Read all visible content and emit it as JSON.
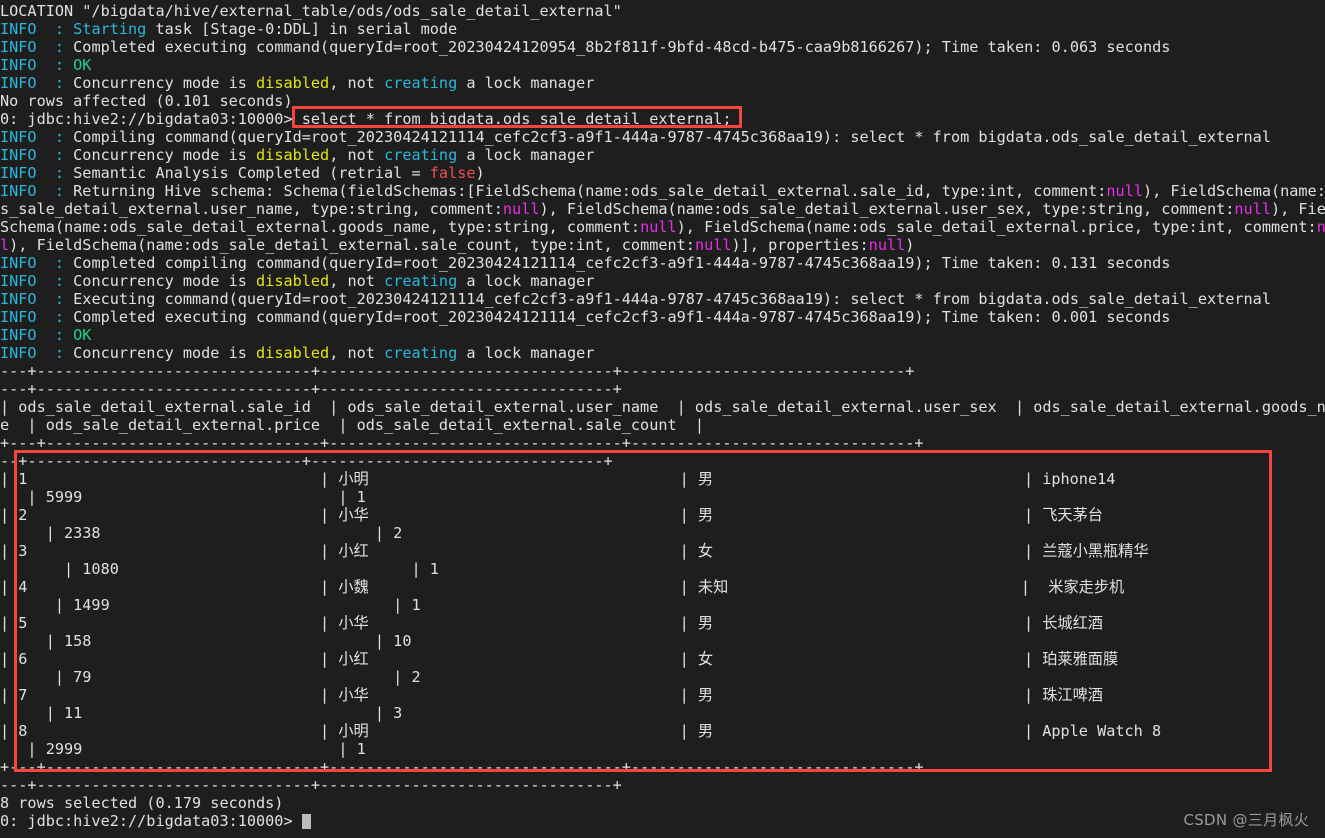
{
  "terminal": {
    "background_color": "#1e1e1e",
    "foreground_color": "#d8d8d8",
    "highlight_color": "#f4463c",
    "prompt": "0: jdbc:hive2://bigdata03:10000>",
    "cursor": "block-cursor"
  },
  "lines": [
    {
      "id": "l01",
      "segments": [
        {
          "t": "LOCATION \"/bigdata/hive/external_table/ods/ods_sale_detail_external\"",
          "c": "white"
        }
      ]
    },
    {
      "id": "l02",
      "segments": [
        {
          "t": "INFO  : ",
          "c": "cyan"
        },
        {
          "t": "Starting",
          "c": "cyan"
        },
        {
          "t": " task [Stage-0:DDL] in serial mode",
          "c": "white"
        }
      ]
    },
    {
      "id": "l03",
      "segments": [
        {
          "t": "INFO  : ",
          "c": "cyan"
        },
        {
          "t": "Completed executing command(queryId=root_20230424120954_8b2f811f-9bfd-48cd-b475-caa9b8166267); Time taken: 0.063 seconds",
          "c": "white"
        }
      ]
    },
    {
      "id": "l04",
      "segments": [
        {
          "t": "INFO  : ",
          "c": "cyan"
        },
        {
          "t": "OK",
          "c": "green"
        }
      ]
    },
    {
      "id": "l05",
      "segments": [
        {
          "t": "INFO  : ",
          "c": "cyan"
        },
        {
          "t": "Concurrency mode is ",
          "c": "white"
        },
        {
          "t": "disabled",
          "c": "yellow"
        },
        {
          "t": ", not ",
          "c": "white"
        },
        {
          "t": "creating",
          "c": "cyan"
        },
        {
          "t": " a lock manager",
          "c": "white"
        }
      ]
    },
    {
      "id": "l06",
      "segments": [
        {
          "t": "No rows affected (0.101 seconds)",
          "c": "white"
        }
      ]
    },
    {
      "id": "l07",
      "segments": [
        {
          "t": "0: jdbc:hive2://bigdata03:10000> ",
          "c": "white"
        },
        {
          "t": "select * from bigdata.ods_sale_detail_external;",
          "c": "white"
        }
      ]
    },
    {
      "id": "l08",
      "segments": [
        {
          "t": "INFO  : ",
          "c": "cyan"
        },
        {
          "t": "Compiling command(queryId=root_20230424121114_cefc2cf3-a9f1-444a-9787-4745c368aa19): select * from bigdata.ods_sale_detail_external",
          "c": "white"
        }
      ]
    },
    {
      "id": "l09",
      "segments": [
        {
          "t": "INFO  : ",
          "c": "cyan"
        },
        {
          "t": "Concurrency mode is ",
          "c": "white"
        },
        {
          "t": "disabled",
          "c": "yellow"
        },
        {
          "t": ", not ",
          "c": "white"
        },
        {
          "t": "creating",
          "c": "cyan"
        },
        {
          "t": " a lock manager",
          "c": "white"
        }
      ]
    },
    {
      "id": "l10",
      "segments": [
        {
          "t": "INFO  : ",
          "c": "cyan"
        },
        {
          "t": "Semantic Analysis Completed (retrial = ",
          "c": "white"
        },
        {
          "t": "false",
          "c": "red"
        },
        {
          "t": ")",
          "c": "white"
        }
      ]
    },
    {
      "id": "l11",
      "segments": [
        {
          "t": "INFO  : ",
          "c": "cyan"
        },
        {
          "t": "Returning Hive schema: Schema(fieldSchemas:[FieldSchema(name:ods_sale_detail_external.sale_id, type:int, comment:",
          "c": "white"
        },
        {
          "t": "null",
          "c": "magenta"
        },
        {
          "t": "), FieldSchema(name:od",
          "c": "white"
        }
      ]
    },
    {
      "id": "l12",
      "segments": [
        {
          "t": "s_sale_detail_external.user_name, type:string, comment:",
          "c": "white"
        },
        {
          "t": "null",
          "c": "magenta"
        },
        {
          "t": "), FieldSchema(name:ods_sale_detail_external.user_sex, type:string, comment:",
          "c": "white"
        },
        {
          "t": "null",
          "c": "magenta"
        },
        {
          "t": "), Field",
          "c": "white"
        }
      ]
    },
    {
      "id": "l13",
      "segments": [
        {
          "t": "Schema(name:ods_sale_detail_external.goods_name, type:string, comment:",
          "c": "white"
        },
        {
          "t": "null",
          "c": "magenta"
        },
        {
          "t": "), FieldSchema(name:ods_sale_detail_external.price, type:int, comment:",
          "c": "white"
        },
        {
          "t": "nul",
          "c": "magenta"
        }
      ]
    },
    {
      "id": "l14",
      "segments": [
        {
          "t": "l",
          "c": "magenta"
        },
        {
          "t": "), FieldSchema(name:ods_sale_detail_external.sale_count, type:int, comment:",
          "c": "white"
        },
        {
          "t": "null",
          "c": "magenta"
        },
        {
          "t": ")], properties:",
          "c": "white"
        },
        {
          "t": "null",
          "c": "magenta"
        },
        {
          "t": ")",
          "c": "white"
        }
      ]
    },
    {
      "id": "l15",
      "segments": [
        {
          "t": "INFO  : ",
          "c": "cyan"
        },
        {
          "t": "Completed compiling command(queryId=root_20230424121114_cefc2cf3-a9f1-444a-9787-4745c368aa19); Time taken: 0.131 seconds",
          "c": "white"
        }
      ]
    },
    {
      "id": "l16",
      "segments": [
        {
          "t": "INFO  : ",
          "c": "cyan"
        },
        {
          "t": "Concurrency mode is ",
          "c": "white"
        },
        {
          "t": "disabled",
          "c": "yellow"
        },
        {
          "t": ", not ",
          "c": "white"
        },
        {
          "t": "creating",
          "c": "cyan"
        },
        {
          "t": " a lock manager",
          "c": "white"
        }
      ]
    },
    {
      "id": "l17",
      "segments": [
        {
          "t": "INFO  : ",
          "c": "cyan"
        },
        {
          "t": "Executing command(queryId=root_20230424121114_cefc2cf3-a9f1-444a-9787-4745c368aa19): select * from bigdata.ods_sale_detail_external",
          "c": "white"
        }
      ]
    },
    {
      "id": "l18",
      "segments": [
        {
          "t": "INFO  : ",
          "c": "cyan"
        },
        {
          "t": "Completed executing command(queryId=root_20230424121114_cefc2cf3-a9f1-444a-9787-4745c368aa19); Time taken: 0.001 seconds",
          "c": "white"
        }
      ]
    },
    {
      "id": "l19",
      "segments": [
        {
          "t": "INFO  : ",
          "c": "cyan"
        },
        {
          "t": "OK",
          "c": "green"
        }
      ]
    },
    {
      "id": "l20",
      "segments": [
        {
          "t": "INFO  : ",
          "c": "cyan"
        },
        {
          "t": "Concurrency mode is ",
          "c": "white"
        },
        {
          "t": "disabled",
          "c": "yellow"
        },
        {
          "t": ", not ",
          "c": "white"
        },
        {
          "t": "creating",
          "c": "cyan"
        },
        {
          "t": " a lock manager",
          "c": "white"
        }
      ]
    },
    {
      "id": "l21",
      "segments": [
        {
          "t": "---+------------------------------+--------------------------------+-------------------------------+",
          "c": "white"
        }
      ]
    },
    {
      "id": "l22",
      "segments": [
        {
          "t": "---+------------------------------+--------------------------------+",
          "c": "white"
        }
      ]
    },
    {
      "id": "l23",
      "segments": [
        {
          "t": "| ods_sale_detail_external.sale_id  | ods_sale_detail_external.user_name  | ods_sale_detail_external.user_sex  | ods_sale_detail_external.goods_nam",
          "c": "white"
        }
      ]
    },
    {
      "id": "l24",
      "segments": [
        {
          "t": "e  | ods_sale_detail_external.price  | ods_sale_detail_external.sale_count  |",
          "c": "white"
        }
      ]
    },
    {
      "id": "l25",
      "segments": [
        {
          "t": "+---+------------------------------+--------------------------------+-------------------------------+",
          "c": "white"
        }
      ]
    },
    {
      "id": "l26",
      "segments": [
        {
          "t": "--+------------------------------+--------------------------------+",
          "c": "white"
        }
      ]
    },
    {
      "id": "l27",
      "segments": [
        {
          "t": "| 1                                | 小明                                  | 男                                  | iphone14",
          "c": "white"
        }
      ]
    },
    {
      "id": "l28",
      "segments": [
        {
          "t": "   | 5999                            | 1",
          "c": "white"
        }
      ]
    },
    {
      "id": "l29",
      "segments": [
        {
          "t": "| 2                                | 小华                                  | 男                                  | 飞天茅台",
          "c": "white"
        }
      ]
    },
    {
      "id": "l30",
      "segments": [
        {
          "t": "     | 2338                              | 2",
          "c": "white"
        }
      ]
    },
    {
      "id": "l31",
      "segments": [
        {
          "t": "| 3                                | 小红                                  | 女                                  | 兰蔻小黑瓶精华",
          "c": "white"
        }
      ]
    },
    {
      "id": "l32",
      "segments": [
        {
          "t": "       | 1080                                | 1",
          "c": "white"
        }
      ]
    },
    {
      "id": "l33",
      "segments": [
        {
          "t": "| 4                                | 小魏                                  | 未知                                |  米家走步机",
          "c": "white"
        }
      ]
    },
    {
      "id": "l34",
      "segments": [
        {
          "t": "      | 1499                               | 1",
          "c": "white"
        }
      ]
    },
    {
      "id": "l35",
      "segments": [
        {
          "t": "| 5                                | 小华                                  | 男                                  | 长城红酒",
          "c": "white"
        }
      ]
    },
    {
      "id": "l36",
      "segments": [
        {
          "t": "     | 158                               | 10",
          "c": "white"
        }
      ]
    },
    {
      "id": "l37",
      "segments": [
        {
          "t": "| 6                                | 小红                                  | 女                                  | 珀莱雅面膜",
          "c": "white"
        }
      ]
    },
    {
      "id": "l38",
      "segments": [
        {
          "t": "      | 79                                 | 2",
          "c": "white"
        }
      ]
    },
    {
      "id": "l39",
      "segments": [
        {
          "t": "| 7                                | 小华                                  | 男                                  | 珠江啤酒",
          "c": "white"
        }
      ]
    },
    {
      "id": "l40",
      "segments": [
        {
          "t": "     | 11                                | 3",
          "c": "white"
        }
      ]
    },
    {
      "id": "l41",
      "segments": [
        {
          "t": "| 8                                | 小明                                  | 男                                  | Apple Watch 8",
          "c": "white"
        }
      ]
    },
    {
      "id": "l42",
      "segments": [
        {
          "t": "   | 2999                            | 1",
          "c": "white"
        }
      ]
    },
    {
      "id": "l43",
      "segments": [
        {
          "t": "+---+------------------------------+--------------------------------+-------------------------------+",
          "c": "white"
        }
      ]
    },
    {
      "id": "l44",
      "segments": [
        {
          "t": "---+------------------------------+--------------------------------+",
          "c": "white"
        }
      ]
    },
    {
      "id": "l45",
      "segments": [
        {
          "t": "8 rows selected (0.179 seconds)",
          "c": "white"
        }
      ]
    }
  ],
  "prompt_line": {
    "text": "0: jdbc:hive2://bigdata03:10000> "
  },
  "sql_command": "select * from bigdata.ods_sale_detail_external;",
  "result_table": {
    "columns": [
      "ods_sale_detail_external.sale_id",
      "ods_sale_detail_external.user_name",
      "ods_sale_detail_external.user_sex",
      "ods_sale_detail_external.goods_name",
      "ods_sale_detail_external.price",
      "ods_sale_detail_external.sale_count"
    ],
    "rows": [
      [
        "1",
        "小明",
        "男",
        "iphone14",
        "5999",
        "1"
      ],
      [
        "2",
        "小华",
        "男",
        "飞天茅台",
        "2338",
        "2"
      ],
      [
        "3",
        "小红",
        "女",
        "兰蔻小黑瓶精华",
        "1080",
        "1"
      ],
      [
        "4",
        "小魏",
        "未知",
        "米家走步机",
        "1499",
        "1"
      ],
      [
        "5",
        "小华",
        "男",
        "长城红酒",
        "158",
        "10"
      ],
      [
        "6",
        "小红",
        "女",
        "珀莱雅面膜",
        "79",
        "2"
      ],
      [
        "7",
        "小华",
        "男",
        "珠江啤酒",
        "11",
        "3"
      ],
      [
        "8",
        "小明",
        "男",
        "Apple Watch 8",
        "2999",
        "1"
      ]
    ],
    "row_count_status": "8 rows selected (0.179 seconds)"
  },
  "watermark": "CSDN @三月枫火"
}
